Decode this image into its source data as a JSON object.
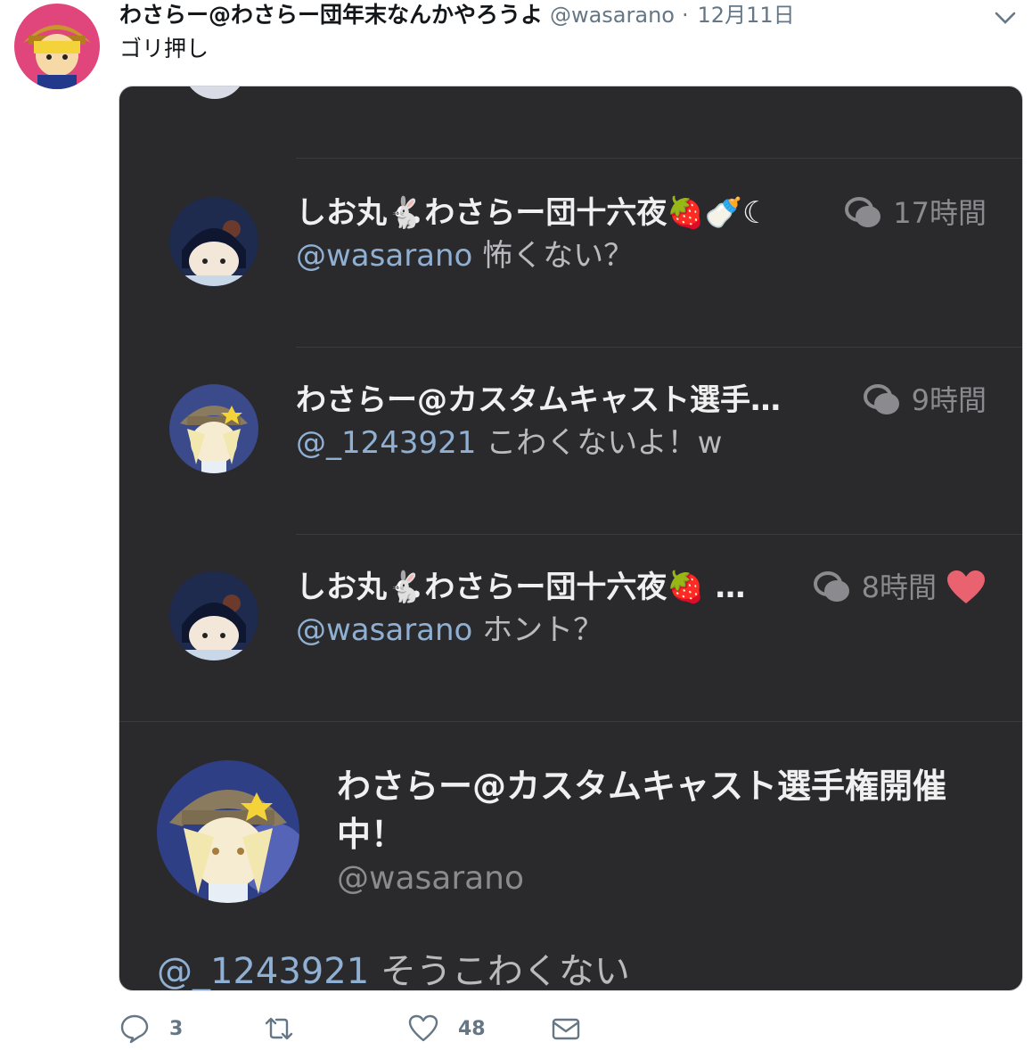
{
  "tweet": {
    "display_name": "わさらー@わさらー団年末なんかやろうよ",
    "handle": "@wasarano",
    "separator": "·",
    "date": "12月11日",
    "text": "ゴリ押し"
  },
  "screenshot": {
    "replies": [
      {
        "name": "しお丸🐇わさらー団十六夜🍓🍼☾",
        "time": "17時間",
        "mention": "@wasarano",
        "text": "怖くない？"
      },
      {
        "name": "わさらー@カスタムキャスト選手…",
        "time": "9時間",
        "mention": "@_1243921",
        "text": "こわくないよ！w"
      },
      {
        "name": "しお丸🐇わさらー団十六夜🍓 …",
        "time": "8時間",
        "mention": "@wasarano",
        "text": "ホント？"
      }
    ],
    "focused": {
      "name": "わさらー@カスタムキャスト選手権開催中！",
      "handle": "@wasarano",
      "mention": "@_1243921",
      "text": "そうこわくない"
    }
  },
  "actions": {
    "reply_count": "3",
    "retweet_count": "",
    "like_count": "48"
  },
  "colors": {
    "card_bg": "#2a2a2d",
    "like_heart": "#e8626f"
  }
}
